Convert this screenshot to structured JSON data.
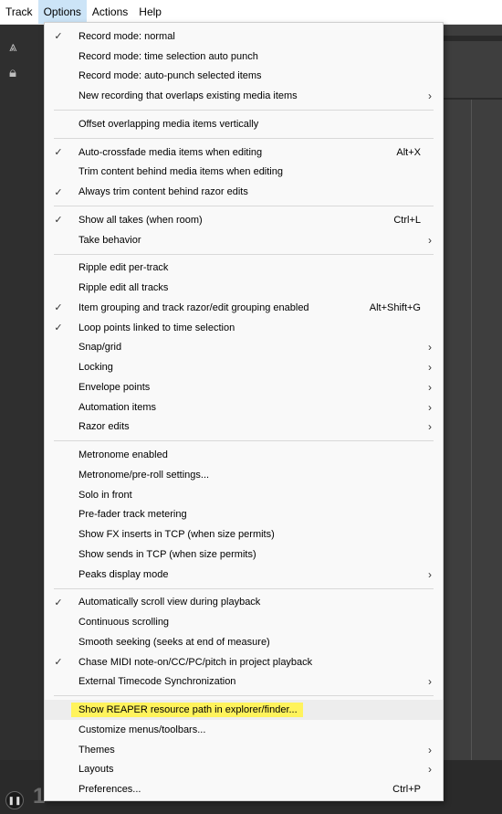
{
  "menubar": {
    "items": [
      {
        "label": "Track"
      },
      {
        "label": "Options"
      },
      {
        "label": "Actions"
      },
      {
        "label": "Help"
      }
    ]
  },
  "background": {
    "left_icons": [
      "metronome-icon",
      "lock-icon"
    ],
    "bottom_number": "1"
  },
  "options_menu": {
    "items": [
      {
        "label": "Record mode: normal",
        "checked": true
      },
      {
        "label": "Record mode: time selection auto punch"
      },
      {
        "label": "Record mode: auto-punch selected items"
      },
      {
        "label": "New recording that overlaps existing media items",
        "submenu": true
      },
      {
        "separator": true
      },
      {
        "label": "Offset overlapping media items vertically"
      },
      {
        "separator": true
      },
      {
        "label": "Auto-crossfade media items when editing",
        "checked": true,
        "shortcut": "Alt+X"
      },
      {
        "label": "Trim content behind media items when editing"
      },
      {
        "label": "Always trim content behind razor edits",
        "checked": true
      },
      {
        "separator": true
      },
      {
        "label": "Show all takes (when room)",
        "checked": true,
        "shortcut": "Ctrl+L"
      },
      {
        "label": "Take behavior",
        "submenu": true
      },
      {
        "separator": true
      },
      {
        "label": "Ripple edit per-track"
      },
      {
        "label": "Ripple edit all tracks"
      },
      {
        "label": "Item grouping and track razor/edit grouping enabled",
        "checked": true,
        "shortcut": "Alt+Shift+G"
      },
      {
        "label": "Loop points linked to time selection",
        "checked": true
      },
      {
        "label": "Snap/grid",
        "submenu": true
      },
      {
        "label": "Locking",
        "submenu": true
      },
      {
        "label": "Envelope points",
        "submenu": true
      },
      {
        "label": "Automation items",
        "submenu": true
      },
      {
        "label": "Razor edits",
        "submenu": true
      },
      {
        "separator": true
      },
      {
        "label": "Metronome enabled"
      },
      {
        "label": "Metronome/pre-roll settings..."
      },
      {
        "label": "Solo in front"
      },
      {
        "label": "Pre-fader track metering"
      },
      {
        "label": "Show FX inserts in TCP (when size permits)"
      },
      {
        "label": "Show sends in TCP (when size permits)"
      },
      {
        "label": "Peaks display mode",
        "submenu": true
      },
      {
        "separator": true
      },
      {
        "label": "Automatically scroll view during playback",
        "checked": true
      },
      {
        "label": "Continuous scrolling"
      },
      {
        "label": "Smooth seeking (seeks at end of measure)"
      },
      {
        "label": "Chase MIDI note-on/CC/PC/pitch in project playback",
        "checked": true
      },
      {
        "label": "External Timecode Synchronization",
        "submenu": true
      },
      {
        "separator": true
      },
      {
        "label": "Show REAPER resource path in explorer/finder...",
        "highlighted": true
      },
      {
        "label": "Customize menus/toolbars..."
      },
      {
        "label": "Themes",
        "submenu": true
      },
      {
        "label": "Layouts",
        "submenu": true
      },
      {
        "label": "Preferences...",
        "shortcut": "Ctrl+P"
      }
    ]
  },
  "glyphs": {
    "check": "✓",
    "arrow": "›",
    "play": "❚❚"
  },
  "colors": {
    "highlight": "#fff35c",
    "hover": "#ededed",
    "menu_bg": "#f9f9f9"
  }
}
